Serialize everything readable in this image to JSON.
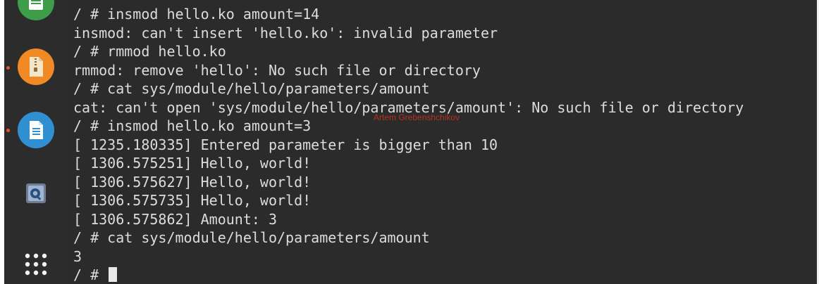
{
  "dock": {
    "items": [
      {
        "name": "top-app",
        "icon": "spreadsheet-icon",
        "color": "#3e9d48"
      },
      {
        "name": "archive-manager",
        "icon": "archive-icon",
        "color": "#f08a24",
        "running": true
      },
      {
        "name": "text-editor",
        "icon": "document-icon",
        "color": "#2f8fd1",
        "running": true
      },
      {
        "name": "virtualbox",
        "icon": "virtualbox-icon",
        "color": "#3b6fa8"
      },
      {
        "name": "show-applications",
        "icon": "app-grid-icon"
      }
    ],
    "accent": "#e95420"
  },
  "terminal": {
    "lines": [
      "/ # insmod hello.ko amount=14",
      "insmod: can't insert 'hello.ko': invalid parameter",
      "/ # rmmod hello.ko",
      "rmmod: remove 'hello': No such file or directory",
      "/ # cat sys/module/hello/parameters/amount",
      "cat: can't open 'sys/module/hello/parameters/amount': No such file or directory",
      "/ # insmod hello.ko amount=3",
      "[ 1235.180335] Entered parameter is bigger than 10",
      "[ 1306.575251] Hello, world!",
      "[ 1306.575627] Hello, world!",
      "[ 1306.575735] Hello, world!",
      "[ 1306.575862] Amount: 3",
      "/ # cat sys/module/hello/parameters/amount",
      "3",
      "/ # "
    ],
    "background": "#2b2b2b",
    "foreground": "#dcdcdc"
  },
  "watermark": {
    "text": "Artem Grebenshchikov",
    "color": "#d0321f"
  }
}
